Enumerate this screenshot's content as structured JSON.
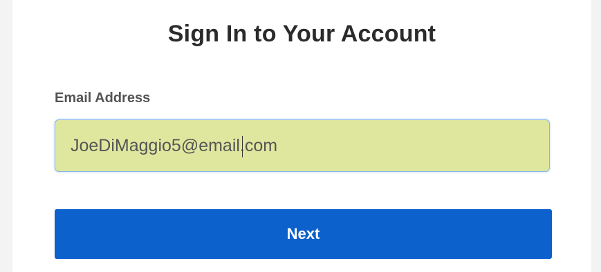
{
  "form": {
    "title": "Sign In to Your Account",
    "email_label": "Email Address",
    "email_value": "JoeDiMaggio5@email.com",
    "next_label": "Next"
  },
  "colors": {
    "page_background": "#f3f3f3",
    "card_background": "#ffffff",
    "input_autofill_background": "#dfe79f",
    "input_focus_border": "#86b7e6",
    "primary_button": "#0c61cc"
  }
}
